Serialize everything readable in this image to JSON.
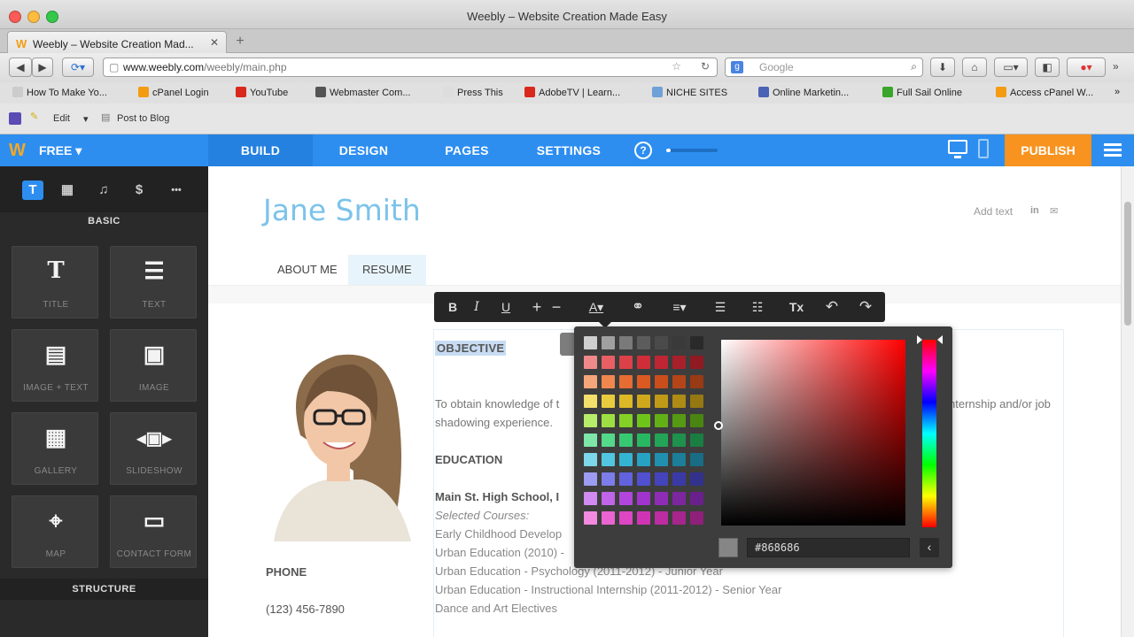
{
  "browser": {
    "window_title": "Weebly – Website Creation Made Easy",
    "tab_title": "Weebly – Website Creation Mad...",
    "url_domain": "www.weebly.com",
    "url_path": "/weebly/main.php",
    "search_placeholder": "Google",
    "bookmarks": [
      {
        "label": "How To Make Yo...",
        "color": "#cccccc"
      },
      {
        "label": "cPanel Login",
        "color": "#f39c12"
      },
      {
        "label": "YouTube",
        "color": "#d9281c"
      },
      {
        "label": "Webmaster Com...",
        "color": "#555555"
      },
      {
        "label": "Press This",
        "color": "#dddddd"
      },
      {
        "label": "AdobeTV | Learn...",
        "color": "#d9281c"
      },
      {
        "label": "NICHE SITES",
        "color": "#6fa0d8"
      },
      {
        "label": "Online Marketin...",
        "color": "#4a63b5"
      },
      {
        "label": "Full Sail Online",
        "color": "#3aa52b"
      },
      {
        "label": "Access cPanel W...",
        "color": "#f39c12"
      }
    ],
    "addon_edit": "Edit",
    "addon_post": "Post to Blog"
  },
  "weebly": {
    "logo": "W",
    "plan": "FREE ▾",
    "nav": [
      "BUILD",
      "DESIGN",
      "PAGES",
      "SETTINGS"
    ],
    "help": "?",
    "save_progress": 0.08,
    "publish": "PUBLISH",
    "colors": {
      "blue": "#2d8ef0",
      "publish": "#f7931e"
    }
  },
  "sidebar": {
    "tabs": [
      "T",
      "▦",
      "♫",
      "$",
      "•••"
    ],
    "section_basic": "BASIC",
    "elements": [
      {
        "label": "TITLE",
        "icon": "T"
      },
      {
        "label": "TEXT",
        "icon": "☰"
      },
      {
        "label": "IMAGE + TEXT",
        "icon": "▤"
      },
      {
        "label": "IMAGE",
        "icon": "▣"
      },
      {
        "label": "GALLERY",
        "icon": "▦"
      },
      {
        "label": "SLIDESHOW",
        "icon": "◂▣▸"
      },
      {
        "label": "MAP",
        "icon": "⌖"
      },
      {
        "label": "CONTACT FORM",
        "icon": "▭"
      }
    ],
    "section_structure": "STRUCTURE"
  },
  "site": {
    "title": "Jane Smith",
    "add_text": "Add text",
    "social_1": "in",
    "social_2": "✉",
    "nav": [
      "ABOUT ME",
      "RESUME"
    ],
    "phone_label": "PHONE",
    "phone": "(123) 456-7890",
    "objective_title": "OBJECTIVE",
    "objective_line1": "To obtain knowledge of t",
    "objective_line1_end": "nternship and/or job",
    "objective_line2": "shadowing experience.",
    "education_title": "EDUCATION",
    "school": "Main St. High School, I",
    "courses_label": "Selected Courses:",
    "courses": [
      "Early Childhood Develop",
      "Urban Education (2010) -",
      "Urban Education - Psychology (2011-2012) - Junior Year",
      "Urban Education - Instructional Internship (2011-2012) - Senior Year",
      "Dance and Art Electives"
    ]
  },
  "toolbar": {
    "bold": "B",
    "italic": "I",
    "underline": "U",
    "plus": "+",
    "minus": "−",
    "font_color": "A▾",
    "link": "⚭",
    "align": "≡▾",
    "bullets": "☰",
    "numbers": "☷",
    "clear": "Tx",
    "undo": "↶",
    "redo": "↷"
  },
  "color_picker": {
    "hex_value": "#868686",
    "current_color": "#868686",
    "back": "‹"
  }
}
